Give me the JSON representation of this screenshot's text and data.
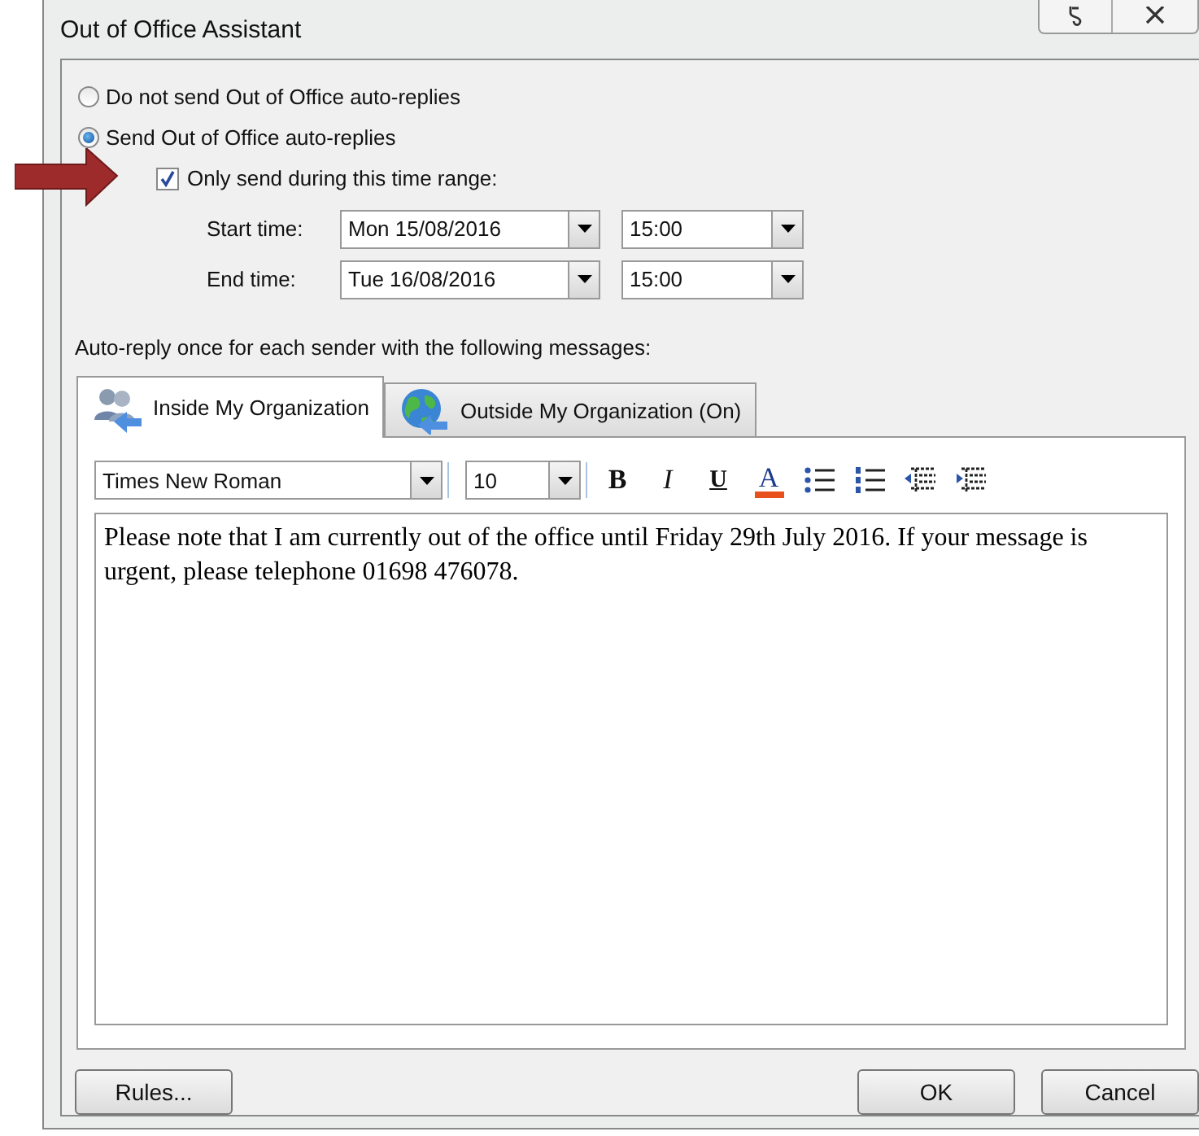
{
  "window": {
    "title": "Out of Office Assistant"
  },
  "reply_options": [
    {
      "label": "Do not send Out of Office auto-replies",
      "selected": false
    },
    {
      "label": "Send Out of Office auto-replies",
      "selected": true
    }
  ],
  "time_range": {
    "label": "Only send during this time range:",
    "checked": true
  },
  "times": [
    {
      "label": "Start time:",
      "date": "Mon 15/08/2016",
      "time": "15:00"
    },
    {
      "label": "End time:",
      "date": "Tue 16/08/2016",
      "time": "15:00"
    }
  ],
  "messages_label": "Auto-reply once for each sender with the following messages:",
  "tabs": [
    {
      "label": "Inside My Organization",
      "kind": "people",
      "selected": true
    },
    {
      "label": "Outside My Organization (On)",
      "kind": "globe",
      "selected": false
    }
  ],
  "toolbar": {
    "font": "Times New Roman",
    "size": "10",
    "format_buttons": [
      {
        "kind": "bold",
        "glyph": "B"
      },
      {
        "kind": "italic",
        "glyph": "I"
      },
      {
        "kind": "underline",
        "glyph": "U"
      },
      {
        "kind": "color",
        "glyph": "A"
      }
    ]
  },
  "message": "Please note that I am currently out of the office until Friday 29th July 2016. If your message is urgent, please telephone 01698 476078.",
  "buttons": [
    {
      "label": "Rules...",
      "kind": "left"
    },
    {
      "label": "OK",
      "kind": "right"
    },
    {
      "label": "Cancel",
      "kind": "right"
    }
  ]
}
